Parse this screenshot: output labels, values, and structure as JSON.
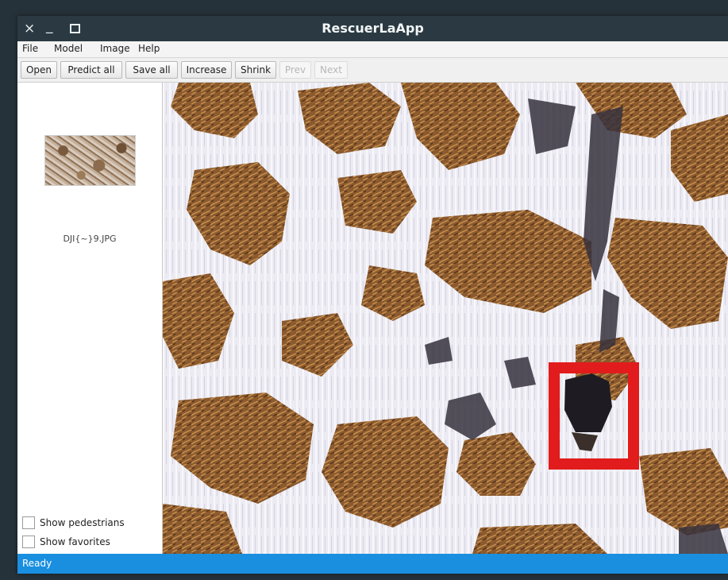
{
  "window": {
    "title": "RescuerLaApp",
    "close_glyph": "×",
    "minimize_glyph": "_",
    "maximize_icon": "maximize-icon"
  },
  "menu": {
    "items": [
      {
        "label": "File"
      },
      {
        "label": "Model"
      },
      {
        "label": "Image"
      },
      {
        "label": "Help"
      }
    ]
  },
  "toolbar": {
    "open_label": "Open",
    "predict_all_label": "Predict all",
    "save_all_label": "Save all",
    "increase_label": "Increase",
    "shrink_label": "Shrink",
    "prev_label": "Prev",
    "next_label": "Next"
  },
  "sidebar": {
    "thumbnail_caption": "DJI{~}9.JPG",
    "show_pedestrians_label": "Show pedestrians",
    "show_favorites_label": "Show favorites",
    "show_pedestrians_checked": false,
    "show_favorites_checked": false
  },
  "viewer": {
    "detection_box_color": "#e21c1c",
    "image_colors": {
      "snow": "#ecebf3",
      "soil": "#8b5a2e",
      "shadow": "#37323d"
    }
  },
  "status": {
    "text": "Ready",
    "color": "#1a8fe0"
  }
}
